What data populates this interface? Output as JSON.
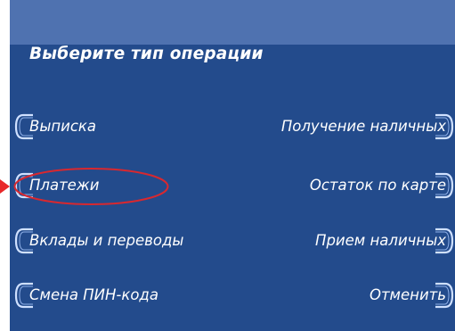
{
  "screen": {
    "title": "Выберите тип операции",
    "left_options": [
      {
        "label": "Выписка"
      },
      {
        "label": "Платежи"
      },
      {
        "label": "Вклады и переводы"
      },
      {
        "label": "Смена ПИН-кода"
      }
    ],
    "right_options": [
      {
        "label": "Получение наличных"
      },
      {
        "label": "Остаток по карте"
      },
      {
        "label": "Прием наличных"
      },
      {
        "label": "Отменить"
      }
    ]
  },
  "colors": {
    "background": "#234b8c",
    "top_band": "#4f72b0",
    "text": "#ffffff",
    "button_frame": "#cfe0ff",
    "highlight": "#d8282f"
  }
}
